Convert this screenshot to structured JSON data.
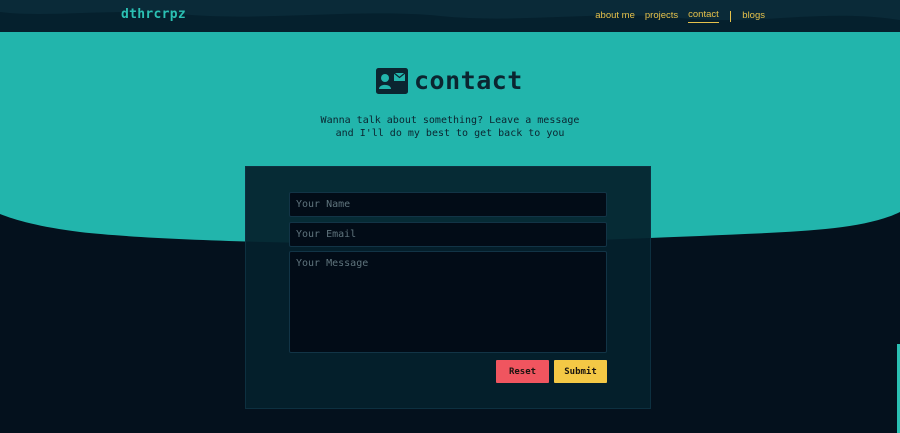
{
  "nav": {
    "brand": "dthrcrpz",
    "links": [
      {
        "label": "about me",
        "active": false
      },
      {
        "label": "projects",
        "active": false
      },
      {
        "label": "contact",
        "active": true
      },
      {
        "label": "blogs",
        "active": false
      }
    ]
  },
  "hero": {
    "title": "contact",
    "icon": "contact-card-icon",
    "subtitle_line1": "Wanna talk about something? Leave a message",
    "subtitle_line2": "and I'll do my best to get back to you"
  },
  "form": {
    "name_placeholder": "Your Name",
    "email_placeholder": "Your Email",
    "message_placeholder": "Your Message",
    "name_value": "",
    "email_value": "",
    "message_value": "",
    "reset_label": "Reset",
    "submit_label": "Submit"
  },
  "colors": {
    "background": "#04111d",
    "teal": "#22b5ac",
    "accent_yellow": "#e5c14b",
    "reset": "#f0555f",
    "submit": "#f4c845"
  }
}
